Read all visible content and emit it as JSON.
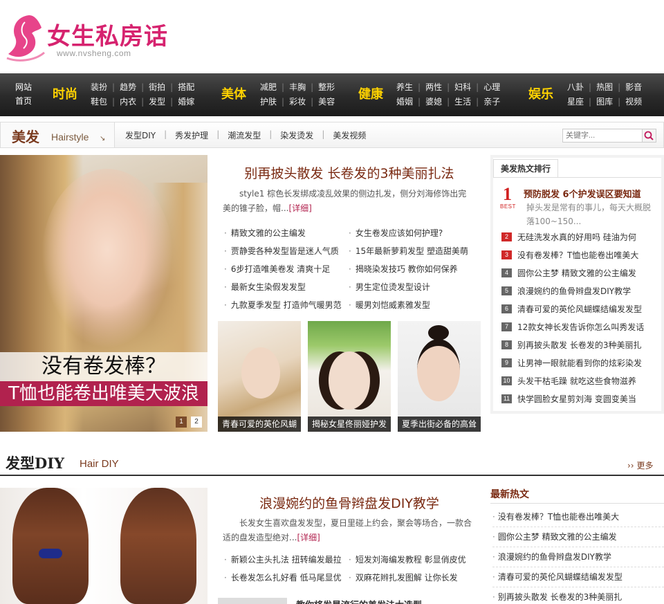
{
  "header": {
    "logo_text": "女生私房话",
    "logo_url": "www.nvsheng.com"
  },
  "nav": {
    "home": [
      "网站",
      "首页"
    ],
    "groups": [
      {
        "cat": "时尚",
        "row1": [
          "装扮",
          "趋势",
          "街拍",
          "搭配"
        ],
        "row2": [
          "鞋包",
          "内衣",
          "发型",
          "婚嫁"
        ]
      },
      {
        "cat": "美体",
        "row1": [
          "减肥",
          "丰胸",
          "整形"
        ],
        "row2": [
          "护肤",
          "彩妆",
          "美容"
        ]
      },
      {
        "cat": "健康",
        "row1": [
          "养生",
          "两性",
          "妇科",
          "心理"
        ],
        "row2": [
          "婚姻",
          "婆媳",
          "生活",
          "亲子"
        ]
      },
      {
        "cat": "娱乐",
        "row1": [
          "八卦",
          "热图",
          "影音"
        ],
        "row2": [
          "星座",
          "图库",
          "视频"
        ]
      }
    ]
  },
  "channel": {
    "title": "美发",
    "subtitle": "Hairstyle",
    "arrow": "↘",
    "links": [
      "发型DIY",
      "秀发护理",
      "潮流发型",
      "染发烫发",
      "美发视频"
    ],
    "search_placeholder": "关键字..."
  },
  "hero": {
    "caption1": "没有卷发棒？",
    "caption2": "T恤也能卷出唯美大波浪",
    "dots": [
      "1",
      "2"
    ]
  },
  "headline": {
    "title": "别再披头散发 长卷发的3种美丽扎法",
    "desc": "style1 棕色长发绑成凌乱效果的侧边扎发，侧分刘海修饰出完美的锥子脸，帽...",
    "more": "[详细]"
  },
  "list_left": [
    "精致文雅的公主编发",
    "贾静雯各种发型皆是迷人气质",
    "6步打造唯美卷发 清爽十足",
    "最新女生染假发发型",
    "九款夏季发型 打造帅气暖男范"
  ],
  "list_right": [
    "女生卷发应该如何护理?",
    "15年最新萝莉发型 塑造甜美萌",
    "揭晓染发技巧 教你如何保养",
    "男生定位烫发型设计",
    "暖男刘恺威素雅发型"
  ],
  "thumbs": [
    "青春可爱的英伦风蝴",
    "揭秘女星佟丽娅护发",
    "夏季出街必备的高耸"
  ],
  "rank": {
    "tab": "美发热文排行",
    "best_num": "1",
    "best_label": "BEST",
    "best_title": "预防脱发 6个护发误区要知道",
    "best_desc": "掉头发是常有的事儿，每天大概脱落100~150...",
    "items": [
      {
        "n": "2",
        "t": "无硅洗发水真的好用吗 硅油为何"
      },
      {
        "n": "3",
        "t": "没有卷发棒？T恤也能卷出唯美大"
      },
      {
        "n": "4",
        "t": "圆你公主梦 精致文雅的公主编发"
      },
      {
        "n": "5",
        "t": "浪漫婉约的鱼骨辫盘发DIY教学"
      },
      {
        "n": "6",
        "t": "清春可爱的英伦风蝴蝶结编发发型"
      },
      {
        "n": "7",
        "t": "12款女神长发告诉你怎么叫秀发话"
      },
      {
        "n": "8",
        "t": "别再披头散发 长卷发的3种美丽扎"
      },
      {
        "n": "9",
        "t": "让男神一眼就能看到你的炫彩染发"
      },
      {
        "n": "10",
        "t": "头发干枯毛躁 就吃这些食物滋养"
      },
      {
        "n": "11",
        "t": "快学圆脸女星剪刘海 变圆变美当"
      }
    ]
  },
  "section2": {
    "title": "发型DIY",
    "subtitle": "Hair  DIY",
    "more": "更多",
    "more_icon": "››",
    "headline": "浪漫婉约的鱼骨辫盘发DIY教学",
    "desc": "长发女生喜欢盘发发型，夏日里碰上约会，聚会等场合，一款合适的盘发造型绝对...",
    "desc_more": "[详细]",
    "list_left": [
      "新颖公主头扎法 扭转编发最拉",
      "长卷发怎么扎好看 低马尾显优"
    ],
    "list_right": [
      "短发刘海编发教程 彰显俏皮优",
      "双麻花辫扎发图解 让你长发"
    ],
    "teaser": "教你将发是流行的美发法大选型",
    "new_title": "最新热文",
    "new_items": [
      "没有卷发棒？T恤也能卷出唯美大",
      "圆你公主梦 精致文雅的公主编发",
      "浪漫婉约的鱼骨辫盘发DIY教学",
      "清春可爱的英伦风蝴蝶结编发发型",
      "别再披头散发 长卷发的3种美丽扎"
    ]
  },
  "colors": {
    "brand": "#d6236f",
    "nav_accent": "#ffd200",
    "title_brown": "#7a2a12",
    "rank_red": "#d02828"
  }
}
